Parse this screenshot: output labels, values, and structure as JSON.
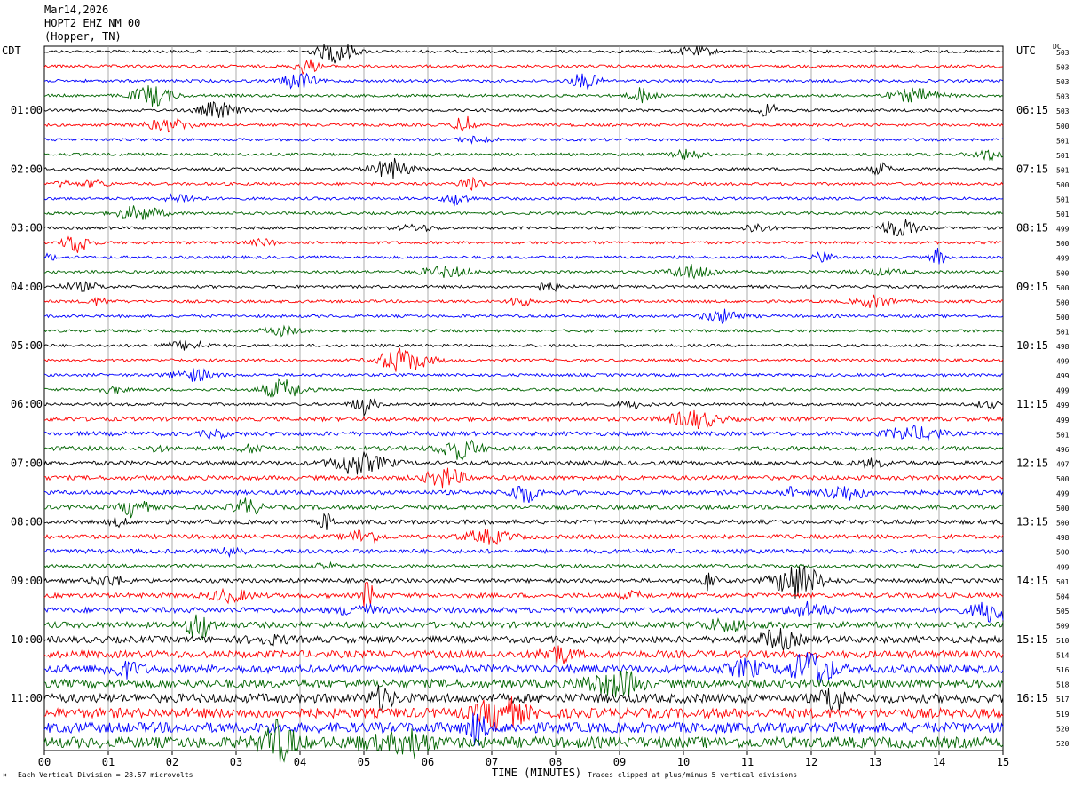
{
  "header": {
    "date": "Mar14,2026",
    "station": "HOPT2 EHZ NM 00",
    "location": "(Hopper, TN)"
  },
  "left_tz": "CDT",
  "right_tz": "UTC",
  "dc_label": "DC",
  "footer": {
    "scale_note": "Each Vertical Division =   28.57 microvolts",
    "clip_note": "Traces clipped at plus/minus 5 vertical divisions",
    "corner_mark": "⨯"
  },
  "colors": {
    "trace_cycle": [
      "#000000",
      "#ff0000",
      "#0000ff",
      "#006400"
    ],
    "grid": "#999999",
    "background": "#ffffff"
  },
  "chart_data": {
    "type": "line",
    "title": "",
    "xlabel": "TIME (MINUTES)",
    "ylabel": "",
    "xlim": [
      0,
      15
    ],
    "x_ticks": [
      "00",
      "01",
      "02",
      "03",
      "04",
      "05",
      "06",
      "07",
      "08",
      "09",
      "10",
      "11",
      "12",
      "13",
      "14",
      "15"
    ],
    "grid": true,
    "trace_count": 48,
    "left_hour_labels": [
      {
        "row": 4,
        "label": "01:00"
      },
      {
        "row": 8,
        "label": "02:00"
      },
      {
        "row": 12,
        "label": "03:00"
      },
      {
        "row": 16,
        "label": "04:00"
      },
      {
        "row": 20,
        "label": "05:00"
      },
      {
        "row": 24,
        "label": "06:00"
      },
      {
        "row": 28,
        "label": "07:00"
      },
      {
        "row": 32,
        "label": "08:00"
      },
      {
        "row": 36,
        "label": "09:00"
      },
      {
        "row": 40,
        "label": "10:00"
      },
      {
        "row": 44,
        "label": "11:00"
      }
    ],
    "right_hour_labels": [
      {
        "row": 4,
        "label": "06:15"
      },
      {
        "row": 8,
        "label": "07:15"
      },
      {
        "row": 12,
        "label": "08:15"
      },
      {
        "row": 16,
        "label": "09:15"
      },
      {
        "row": 20,
        "label": "10:15"
      },
      {
        "row": 24,
        "label": "11:15"
      },
      {
        "row": 28,
        "label": "12:15"
      },
      {
        "row": 32,
        "label": "13:15"
      },
      {
        "row": 36,
        "label": "14:15"
      },
      {
        "row": 40,
        "label": "15:15"
      },
      {
        "row": 44,
        "label": "16:15"
      }
    ],
    "dc_offsets": [
      "503",
      "503",
      "503",
      "503",
      "503",
      "500",
      "501",
      "501",
      "501",
      "500",
      "501",
      "501",
      "499",
      "500",
      "499",
      "500",
      "500",
      "500",
      "500",
      "501",
      "498",
      "499",
      "499",
      "499",
      "499",
      "499",
      "501",
      "496",
      "497",
      "500",
      "499",
      "500",
      "500",
      "498",
      "500",
      "499",
      "501",
      "504",
      "505",
      "509",
      "510",
      "514",
      "516",
      "518",
      "517",
      "519",
      "520",
      "520"
    ]
  }
}
